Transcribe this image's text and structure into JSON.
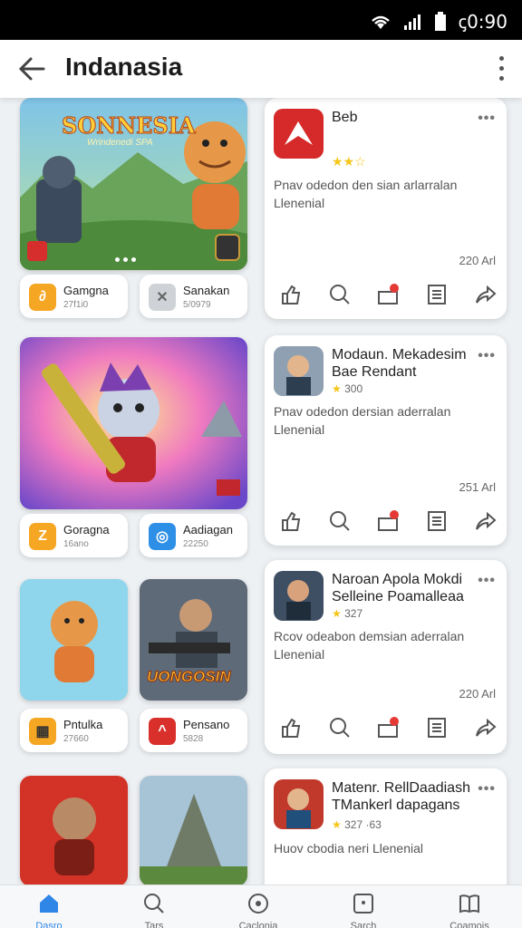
{
  "status_bar": {
    "time": "ꞔ0:90"
  },
  "app_bar": {
    "title": "Indanasia"
  },
  "rows": [
    {
      "game_tile_title": "SONNESIA",
      "game_tile_subtitle": "Wrindenedi SPA",
      "mini_cards": [
        {
          "name": "Gamgna",
          "sub": "27f1i0",
          "color": "#f5a623"
        },
        {
          "name": "Sanakan",
          "sub": "5/0979",
          "color": "#cfd3d8"
        }
      ],
      "info": {
        "name": "Beb",
        "rating": "",
        "desc": "Pnav odedon den sian arlarralan Llenenial",
        "date": "220 Arl"
      }
    },
    {
      "game_tile_title": "",
      "game_tile_subtitle": "",
      "mini_cards": [
        {
          "name": "Goragna",
          "sub": "16ano",
          "color": "#f5a623"
        },
        {
          "name": "Aadiagan",
          "sub": "22250",
          "color": "#2d8fe6"
        }
      ],
      "info": {
        "name": "Modaun. Mekadesim Bae Rendant",
        "rating": "300",
        "desc": "Pnav odedon dersian aderralan Llenenial",
        "date": "251 Arl"
      }
    },
    {
      "game_tile_title": "UONGOSIN",
      "game_tile_subtitle": "",
      "mini_cards": [
        {
          "name": "Pntulka",
          "sub": "27660",
          "color": "#f5a623"
        },
        {
          "name": "Pensano",
          "sub": "5828",
          "color": "#d9302b"
        }
      ],
      "info": {
        "name": "Naroan Apola Mokdi Selleine Poamalleaa",
        "rating": "327",
        "desc": "Rcov odeabon demsian aderralan Llenenial",
        "date": "220 Arl"
      }
    },
    {
      "info": {
        "name": "Matenr. RellDaadiash TMankerl dapagans",
        "rating": "327 ·63",
        "desc": "Huov cbodia neri Llenenial",
        "date": ""
      }
    }
  ],
  "bottom_nav": [
    {
      "label": "Dasro",
      "icon": "home-icon",
      "active": true
    },
    {
      "label": "Tars",
      "icon": "search-icon",
      "active": false
    },
    {
      "label": "Caclonia",
      "icon": "target-icon",
      "active": false
    },
    {
      "label": "Sarch",
      "icon": "square-dot-icon",
      "active": false
    },
    {
      "label": "Coamois",
      "icon": "book-icon",
      "active": false
    }
  ],
  "colors": {
    "accent": "#2f86e6",
    "star": "#f5c518",
    "badge_red": "#e53935"
  }
}
